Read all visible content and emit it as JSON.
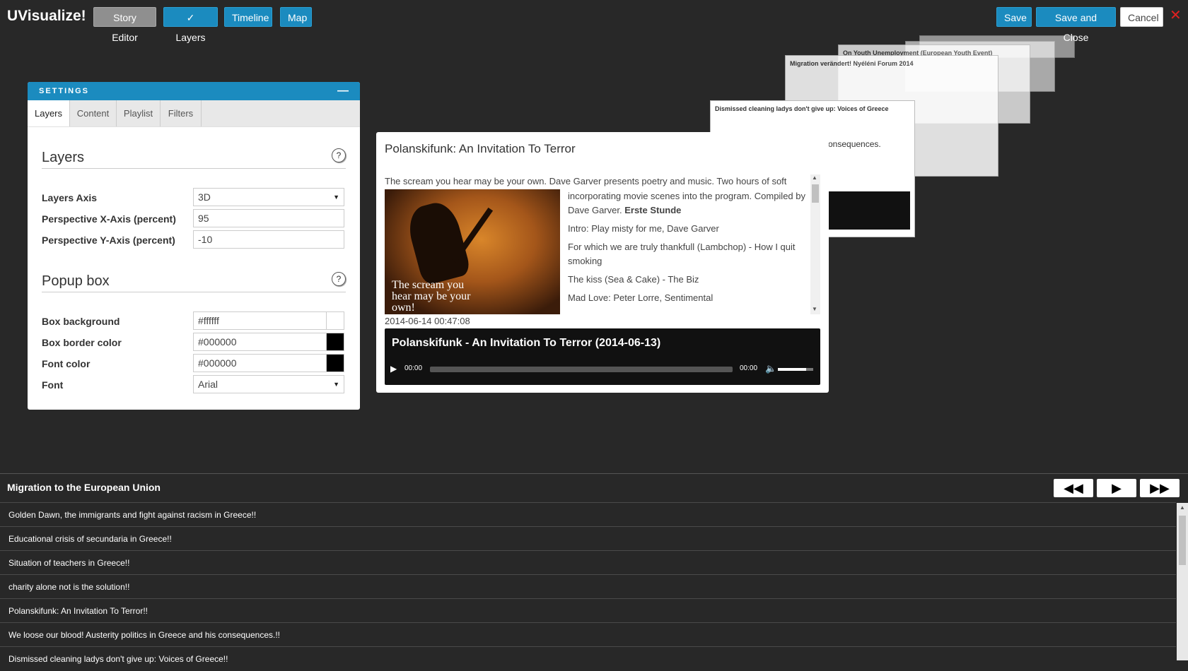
{
  "app": {
    "title": "UVisualize!"
  },
  "toolbar": {
    "story_editor": "Story Editor",
    "layers": "✓ Layers",
    "timeline": "Timeline",
    "map": "Map",
    "save": "Save",
    "save_close": "Save and Close",
    "cancel": "Cancel",
    "close_glyph": "✕"
  },
  "settings": {
    "header": "SETTINGS",
    "minimize_glyph": "—",
    "tabs": [
      "Layers",
      "Content",
      "Playlist",
      "Filters"
    ],
    "active_tab": "Layers",
    "layers_section": {
      "title": "Layers",
      "help": "?",
      "fields": [
        {
          "label": "Layers Axis",
          "value": "3D",
          "type": "select"
        },
        {
          "label": "Perspective X-Axis (percent)",
          "value": "95",
          "type": "text"
        },
        {
          "label": "Perspective Y-Axis (percent)",
          "value": "-10",
          "type": "text"
        }
      ]
    },
    "popup_section": {
      "title": "Popup box",
      "help": "?",
      "fields": [
        {
          "label": "Box background",
          "value": "#ffffff",
          "swatch": "#ffffff"
        },
        {
          "label": "Box border color",
          "value": "#000000",
          "swatch": "#000000"
        },
        {
          "label": "Font color",
          "value": "#000000",
          "swatch": "#000000"
        },
        {
          "label": "Font",
          "value": "Arial",
          "type": "select"
        }
      ]
    }
  },
  "popup": {
    "title": "Polanskifunk: An Invitation To Terror",
    "description": "The scream you hear may be your own. Dave Garver presents poetry and music. Two hours of soft music",
    "desc_cont_1": "incorporating movie scenes into the program. Compiled by",
    "desc_cont_2": "Dave Garver.",
    "desc_bold": "Erste Stunde",
    "image_caption": "The scream you hear may be your own!",
    "tracks": [
      "Intro: Play misty for me, Dave Garver",
      "For which we are truly thankfull (Lambchop) - How I quit smoking",
      "The kiss (Sea & Cake) - The Biz",
      "Mad Love: Peter Lorre, Sentimental"
    ],
    "date": "2014-06-14 00:47:08",
    "player": {
      "title": "Polanskifunk - An Invitation To Terror (2014-06-13)",
      "current": "00:00",
      "duration": "00:00"
    }
  },
  "background_layers": [
    {
      "title": "Dismissed cleaning ladys don't give up: Voices of Greece"
    },
    {
      "title": "Migration verändert! Nyéléni Forum 2014"
    },
    {
      "title": "On Youth Unemployment (European Youth Event)"
    },
    {
      "title": "consequences."
    }
  ],
  "story": {
    "title": "Migration to the European Union",
    "controls": {
      "rewind": "◀◀",
      "play": "▶",
      "forward": "▶▶"
    },
    "items": [
      "Golden Dawn, the immigrants and fight against racism in Greece!!",
      "Educational crisis of secundaria in Greece!!",
      "Situation of teachers in Greece!!",
      "charity alone not is the solution!!",
      "Polanskifunk: An Invitation To Terror!!",
      "We loose our blood! Austerity politics in Greece and his consequences.!!",
      "Dismissed cleaning ladys don't give up: Voices of Greece!!"
    ]
  },
  "colors": {
    "accent": "#1b8bbf",
    "background": "#282828",
    "close": "#e02020"
  }
}
